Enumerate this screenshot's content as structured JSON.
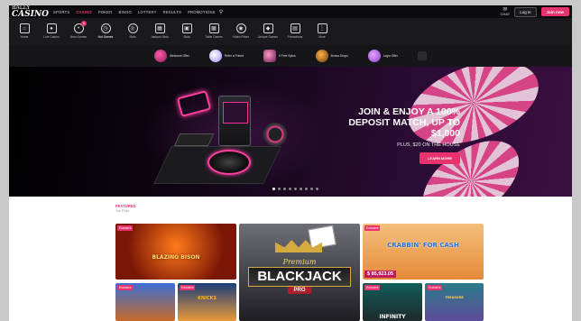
{
  "topbar": {
    "logo_small": "BALLY",
    "logo_big": "CASINO",
    "nav": [
      "SPORTS",
      "CASINO",
      "POKER",
      "BINGO",
      "LOTTERY",
      "RESULTS",
      "PROMOTIONS"
    ],
    "active_nav_index": 1,
    "chat_label": "CHAT",
    "login_label": "Log in",
    "join_label": "Join now"
  },
  "categories": [
    {
      "label": "Home",
      "icon": "home-icon"
    },
    {
      "label": "Live Casino",
      "icon": "cards-icon"
    },
    {
      "label": "New Games",
      "icon": "chat-icon",
      "badge": "5"
    },
    {
      "label": "Hot Games",
      "icon": "clock-icon"
    },
    {
      "label": "Slots",
      "icon": "coin-icon"
    },
    {
      "label": "Jackpot Slots",
      "icon": "grid-icon"
    },
    {
      "label": "Slots",
      "icon": "box-icon"
    },
    {
      "label": "Table Games",
      "icon": "grid-icon"
    },
    {
      "label": "Video Poker",
      "icon": "target-icon"
    },
    {
      "label": "Unique Games",
      "icon": "diamond-icon"
    },
    {
      "label": "Promotions",
      "icon": "gift-icon"
    },
    {
      "label": "More",
      "icon": "dots-icon"
    }
  ],
  "active_category_index": 3,
  "promos": [
    {
      "text": "Welcome Offer"
    },
    {
      "text": "Refer a Friend"
    },
    {
      "text": "5 Free Spins"
    },
    {
      "text": "Bonus Drops"
    },
    {
      "text": "Login Offer"
    }
  ],
  "hero": {
    "headline": "JOIN & ENJOY A 100% DEPOSIT MATCH, UP TO $1,000",
    "subline": "PLUS, $20 ON THE HOUSE",
    "cta": "LEARN MORE",
    "slide_count": 9,
    "active_slide": 0
  },
  "featured": {
    "title": "FEATURED",
    "subtitle": "Top Picks"
  },
  "tiles": [
    {
      "tag": "Exclusive",
      "name": "BLAZING BISON"
    },
    {
      "tag": "",
      "premium": "Premium",
      "name": "BLACKJACK",
      "sub": "PRO"
    },
    {
      "tag": "Exclusive",
      "name": "CRABBIN' FOR CASH",
      "jackpot": "$ 85,923.05"
    },
    {
      "tag": "Exclusive",
      "name": ""
    },
    {
      "tag": "Exclusive",
      "name": "KNICKS"
    },
    {
      "tag": "Exclusive",
      "name": "INFINITY"
    },
    {
      "tag": "Exclusive",
      "name": "TREASURE"
    }
  ],
  "colors": {
    "accent": "#e8326e",
    "bg_dark": "#101014",
    "content_bg": "#ffffff"
  }
}
